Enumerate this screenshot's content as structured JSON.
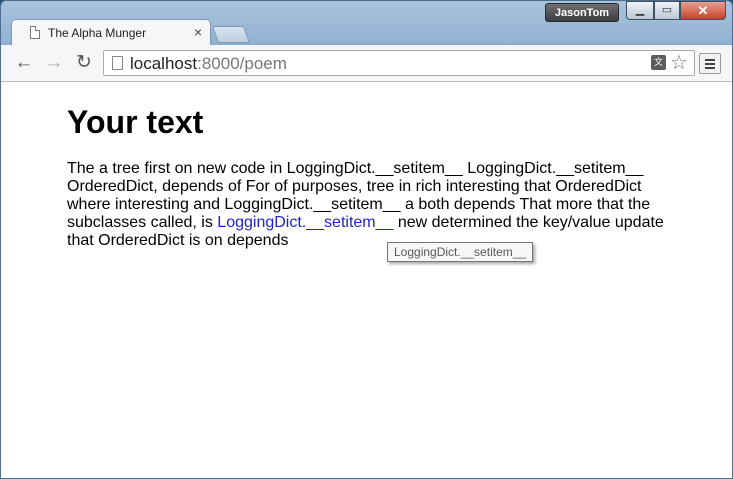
{
  "browser": {
    "tab_title": "The Alpha Munger",
    "tab_close": "×",
    "user_name": "JasonTom",
    "url_host": "localhost",
    "url_rest": ":8000/poem"
  },
  "page": {
    "heading": "Your text",
    "poem_before": "The a tree first on new code in LoggingDict.__setitem__ LoggingDict.__setitem__ OrderedDict, depends of For of purposes, tree in rich interesting that OrderedDict where interesting and LoggingDict.__setitem__ a both depends That more that the subclasses called, is ",
    "poem_link": "LoggingDict.__setitem__",
    "poem_after": " new determined the key/value update that OrderedDict is on depends",
    "tooltip": "LoggingDict.__setitem__"
  },
  "icons": {
    "back": "arrow-left-icon",
    "forward": "arrow-right-icon",
    "reload": "reload-icon",
    "star": "star-icon",
    "translate": "translate-icon",
    "menu": "hamburger-menu-icon"
  },
  "colors": {
    "link": "#2222cc",
    "close_button": "#c7402a"
  }
}
